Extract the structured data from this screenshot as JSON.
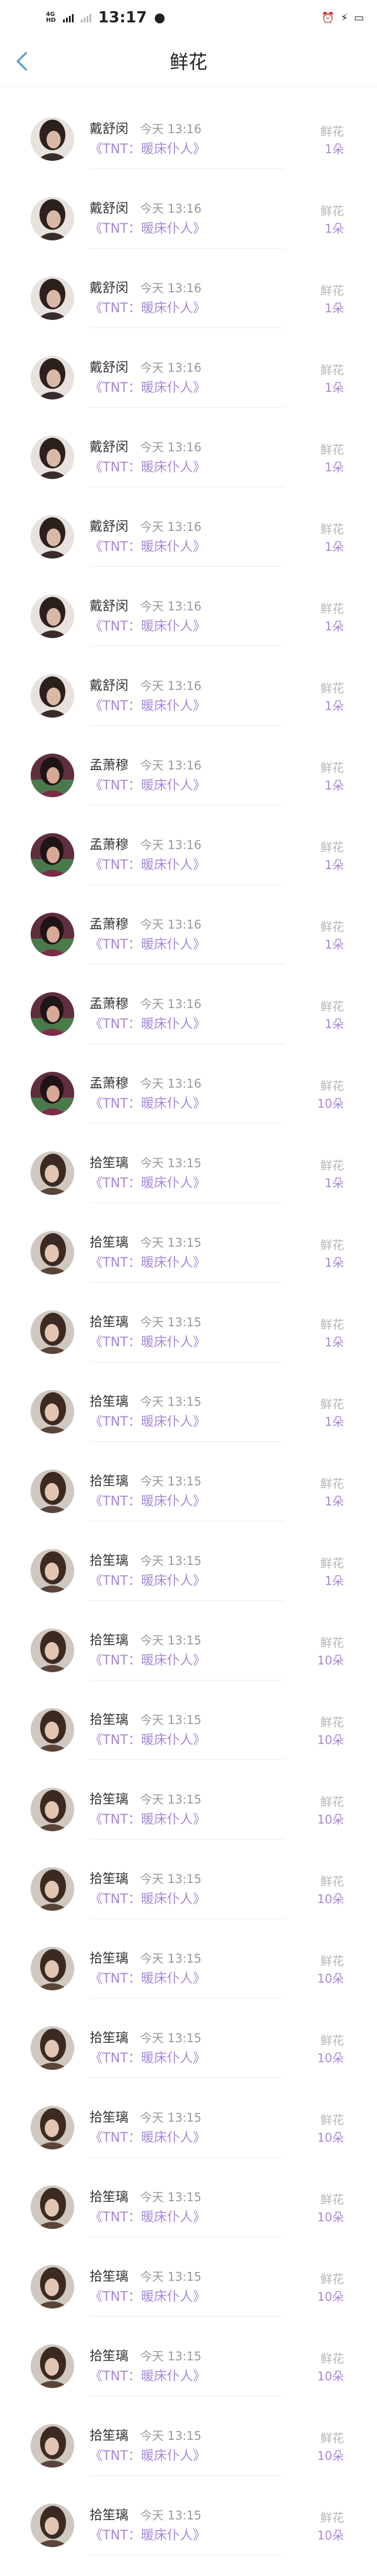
{
  "status_bar": {
    "signal_label": "4G",
    "signal_sub": "HD",
    "time": "13:17"
  },
  "nav": {
    "title": "鲜花"
  },
  "work_title": "《TNT：暖床仆人》",
  "gift_type": "鲜花",
  "items": [
    {
      "name": "戴舒闵",
      "time": "今天 13:16",
      "count": "1朵",
      "avatar": "a"
    },
    {
      "name": "戴舒闵",
      "time": "今天 13:16",
      "count": "1朵",
      "avatar": "a"
    },
    {
      "name": "戴舒闵",
      "time": "今天 13:16",
      "count": "1朵",
      "avatar": "a"
    },
    {
      "name": "戴舒闵",
      "time": "今天 13:16",
      "count": "1朵",
      "avatar": "a"
    },
    {
      "name": "戴舒闵",
      "time": "今天 13:16",
      "count": "1朵",
      "avatar": "a"
    },
    {
      "name": "戴舒闵",
      "time": "今天 13:16",
      "count": "1朵",
      "avatar": "a"
    },
    {
      "name": "戴舒闵",
      "time": "今天 13:16",
      "count": "1朵",
      "avatar": "a"
    },
    {
      "name": "戴舒闵",
      "time": "今天 13:16",
      "count": "1朵",
      "avatar": "a"
    },
    {
      "name": "孟萧穆",
      "time": "今天 13:16",
      "count": "1朵",
      "avatar": "b"
    },
    {
      "name": "孟萧穆",
      "time": "今天 13:16",
      "count": "1朵",
      "avatar": "b"
    },
    {
      "name": "孟萧穆",
      "time": "今天 13:16",
      "count": "1朵",
      "avatar": "b"
    },
    {
      "name": "孟萧穆",
      "time": "今天 13:16",
      "count": "1朵",
      "avatar": "b"
    },
    {
      "name": "孟萧穆",
      "time": "今天 13:16",
      "count": "10朵",
      "avatar": "b"
    },
    {
      "name": "拾笙璃",
      "time": "今天 13:15",
      "count": "1朵",
      "avatar": "c"
    },
    {
      "name": "拾笙璃",
      "time": "今天 13:15",
      "count": "1朵",
      "avatar": "c"
    },
    {
      "name": "拾笙璃",
      "time": "今天 13:15",
      "count": "1朵",
      "avatar": "c"
    },
    {
      "name": "拾笙璃",
      "time": "今天 13:15",
      "count": "1朵",
      "avatar": "c"
    },
    {
      "name": "拾笙璃",
      "time": "今天 13:15",
      "count": "1朵",
      "avatar": "c"
    },
    {
      "name": "拾笙璃",
      "time": "今天 13:15",
      "count": "1朵",
      "avatar": "c"
    },
    {
      "name": "拾笙璃",
      "time": "今天 13:15",
      "count": "10朵",
      "avatar": "c"
    },
    {
      "name": "拾笙璃",
      "time": "今天 13:15",
      "count": "10朵",
      "avatar": "c"
    },
    {
      "name": "拾笙璃",
      "time": "今天 13:15",
      "count": "10朵",
      "avatar": "c"
    },
    {
      "name": "拾笙璃",
      "time": "今天 13:15",
      "count": "10朵",
      "avatar": "c"
    },
    {
      "name": "拾笙璃",
      "time": "今天 13:15",
      "count": "10朵",
      "avatar": "c"
    },
    {
      "name": "拾笙璃",
      "time": "今天 13:15",
      "count": "10朵",
      "avatar": "c"
    },
    {
      "name": "拾笙璃",
      "time": "今天 13:15",
      "count": "10朵",
      "avatar": "c"
    },
    {
      "name": "拾笙璃",
      "time": "今天 13:15",
      "count": "10朵",
      "avatar": "c"
    },
    {
      "name": "拾笙璃",
      "time": "今天 13:15",
      "count": "10朵",
      "avatar": "c"
    },
    {
      "name": "拾笙璃",
      "time": "今天 13:15",
      "count": "10朵",
      "avatar": "c"
    },
    {
      "name": "拾笙璃",
      "time": "今天 13:15",
      "count": "10朵",
      "avatar": "c"
    },
    {
      "name": "拾笙璃",
      "time": "今天 13:15",
      "count": "10朵",
      "avatar": "c"
    }
  ],
  "colors": {
    "accent": "#a889d8",
    "back_icon": "#5aa0d8",
    "muted": "#999999"
  },
  "icons": {
    "back": "back-chevron-icon",
    "avatar": "avatar-photo"
  }
}
